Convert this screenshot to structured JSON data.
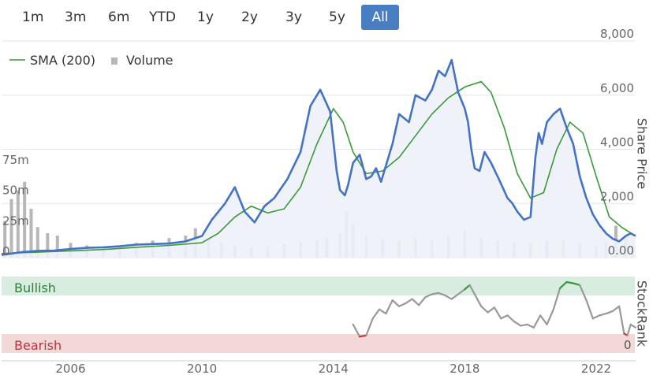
{
  "range_selector": {
    "buttons": [
      "1m",
      "3m",
      "6m",
      "YTD",
      "1y",
      "2y",
      "3y",
      "5y",
      "All"
    ],
    "active": "All",
    "active_color": "#4a7ec2"
  },
  "legend": {
    "sma_label": "SMA (200)",
    "volume_label": "Volume"
  },
  "colors": {
    "price": "#4472c4",
    "sma": "#3a9a3a",
    "volume": "#b7b7b7",
    "area_fill": "#eef1f8",
    "bullish_band": "#d8ece0",
    "bearish_band": "#f3d8d8",
    "rank_line": "#999999",
    "rank_bull": "#2e9a3e",
    "rank_bear": "#d0303a"
  },
  "chart_data": [
    {
      "type": "line",
      "title": "",
      "ylabel": "Share Price",
      "y_ticks": [
        "0.00",
        "2,000",
        "4,000",
        "6,000",
        "8,000"
      ],
      "ylim": [
        0,
        8000
      ],
      "x_ticks": [
        "2006",
        "2010",
        "2014",
        "2018",
        "2022"
      ],
      "xlim": [
        2003.9,
        2023.2
      ],
      "grid": true,
      "legend_position": "top-left",
      "series": [
        {
          "name": "Share Price",
          "x": [
            2003.9,
            2004.5,
            2005.0,
            2005.5,
            2006.0,
            2006.5,
            2007.0,
            2007.5,
            2008.0,
            2008.5,
            2009.0,
            2009.5,
            2010.0,
            2010.3,
            2010.7,
            2011.0,
            2011.3,
            2011.6,
            2011.9,
            2012.2,
            2012.6,
            2013.0,
            2013.3,
            2013.6,
            2013.9,
            2014.1,
            2014.2,
            2014.35,
            2014.45,
            2014.6,
            2014.8,
            2015.0,
            2015.15,
            2015.3,
            2015.45,
            2015.6,
            2015.8,
            2016.0,
            2016.3,
            2016.5,
            2016.8,
            2017.0,
            2017.2,
            2017.4,
            2017.6,
            2017.8,
            2018.0,
            2018.1,
            2018.2,
            2018.3,
            2018.45,
            2018.6,
            2018.8,
            2019.0,
            2019.15,
            2019.3,
            2019.45,
            2019.6,
            2019.8,
            2020.0,
            2020.15,
            2020.25,
            2020.35,
            2020.5,
            2020.7,
            2020.9,
            2021.1,
            2021.3,
            2021.5,
            2021.7,
            2021.9,
            2022.1,
            2022.3,
            2022.5,
            2022.7,
            2022.9,
            2023.05,
            2023.2
          ],
          "values": [
            100,
            200,
            250,
            260,
            320,
            360,
            380,
            420,
            480,
            500,
            520,
            600,
            800,
            1400,
            2000,
            2600,
            1700,
            1300,
            1900,
            2200,
            2900,
            3900,
            5600,
            6200,
            5400,
            3200,
            2500,
            2300,
            2700,
            3500,
            3800,
            2900,
            3000,
            3300,
            2800,
            3400,
            4200,
            5300,
            5000,
            6000,
            5800,
            6200,
            6900,
            6700,
            7300,
            6100,
            5500,
            5000,
            4000,
            3300,
            3200,
            3900,
            3500,
            3000,
            2600,
            2200,
            2000,
            1700,
            1400,
            1500,
            3700,
            4600,
            4200,
            5000,
            5300,
            5500,
            4800,
            4200,
            3000,
            2200,
            1600,
            1200,
            900,
            700,
            600,
            800,
            900,
            800
          ]
        },
        {
          "name": "SMA (200)",
          "x": [
            2003.9,
            2005.0,
            2006.0,
            2007.0,
            2008.0,
            2009.0,
            2010.0,
            2010.5,
            2011.0,
            2011.5,
            2012.0,
            2012.5,
            2013.0,
            2013.5,
            2014.0,
            2014.3,
            2014.6,
            2015.0,
            2015.5,
            2016.0,
            2016.5,
            2017.0,
            2017.5,
            2018.0,
            2018.5,
            2018.8,
            2019.2,
            2019.6,
            2020.0,
            2020.4,
            2020.8,
            2021.2,
            2021.6,
            2022.0,
            2022.4,
            2022.8,
            2023.2
          ],
          "values": [
            150,
            200,
            250,
            300,
            380,
            450,
            550,
            900,
            1500,
            1900,
            1650,
            1800,
            2600,
            4200,
            5500,
            5000,
            3900,
            3100,
            3200,
            3700,
            4500,
            5300,
            5900,
            6300,
            6500,
            6100,
            4800,
            3100,
            2200,
            2400,
            4000,
            5000,
            4600,
            3000,
            1500,
            1100,
            800
          ]
        }
      ]
    },
    {
      "type": "bar",
      "name": "Volume",
      "y_ticks": [
        "0",
        "25m",
        "50m",
        "75m"
      ],
      "ylim": [
        0,
        100
      ],
      "x": [
        2004.0,
        2004.2,
        2004.4,
        2004.6,
        2004.8,
        2005.0,
        2005.3,
        2005.6,
        2006.0,
        2006.5,
        2007.0,
        2007.5,
        2008.0,
        2008.5,
        2009.0,
        2009.5,
        2009.8,
        2010.2,
        2010.6,
        2011.0,
        2011.5,
        2012.0,
        2012.5,
        2013.0,
        2013.5,
        2013.8,
        2014.2,
        2014.4,
        2014.6,
        2015.0,
        2015.5,
        2016.0,
        2016.5,
        2017.0,
        2017.5,
        2018.0,
        2018.5,
        2019.0,
        2019.5,
        2020.0,
        2020.5,
        2021.0,
        2021.5,
        2022.0,
        2022.3,
        2022.6,
        2022.9,
        2023.1
      ],
      "values": [
        30,
        48,
        55,
        62,
        40,
        25,
        20,
        18,
        12,
        10,
        9,
        10,
        12,
        14,
        16,
        18,
        24,
        16,
        12,
        10,
        9,
        10,
        11,
        12,
        14,
        16,
        20,
        38,
        28,
        18,
        15,
        14,
        16,
        15,
        18,
        22,
        16,
        14,
        12,
        12,
        14,
        15,
        12,
        10,
        12,
        26,
        18,
        10
      ]
    },
    {
      "type": "line",
      "title": "",
      "ylabel": "StockRank",
      "bands": [
        "Bullish",
        "Bearish"
      ],
      "y_tick": "0",
      "ylim": [
        0,
        100
      ],
      "x": [
        2014.6,
        2014.8,
        2015.0,
        2015.2,
        2015.4,
        2015.6,
        2015.8,
        2016.0,
        2016.2,
        2016.4,
        2016.6,
        2016.8,
        2017.0,
        2017.2,
        2017.4,
        2017.6,
        2017.8,
        2018.0,
        2018.15,
        2018.3,
        2018.5,
        2018.7,
        2018.9,
        2019.1,
        2019.3,
        2019.5,
        2019.7,
        2019.9,
        2020.1,
        2020.3,
        2020.5,
        2020.7,
        2020.9,
        2021.1,
        2021.3,
        2021.5,
        2021.7,
        2021.9,
        2022.1,
        2022.3,
        2022.5,
        2022.7,
        2022.85,
        2022.95,
        2023.05,
        2023.2
      ],
      "values": [
        30,
        10,
        12,
        40,
        55,
        48,
        70,
        60,
        65,
        72,
        62,
        75,
        80,
        82,
        78,
        72,
        80,
        88,
        95,
        80,
        60,
        50,
        58,
        40,
        45,
        35,
        28,
        30,
        25,
        45,
        30,
        55,
        90,
        100,
        98,
        95,
        70,
        40,
        45,
        48,
        52,
        60,
        15,
        12,
        30,
        25
      ],
      "bull_threshold": 85,
      "bear_threshold": 15
    }
  ]
}
